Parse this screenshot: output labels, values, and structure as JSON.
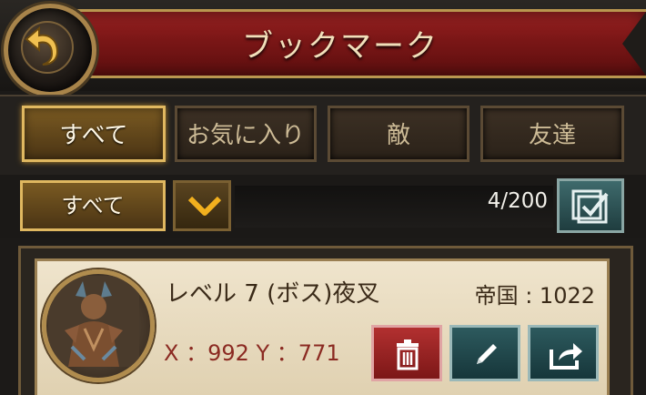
{
  "header": {
    "title": "ブックマーク",
    "back_icon": "back-arrow-icon"
  },
  "tabs": [
    {
      "label": "すべて",
      "active": true
    },
    {
      "label": "お気に入り",
      "active": false
    },
    {
      "label": "敵",
      "active": false
    },
    {
      "label": "友達",
      "active": false
    }
  ],
  "filter": {
    "selected": "すべて",
    "count": "4/200"
  },
  "bookmarks": [
    {
      "name": "レベル 7 (ボス)夜叉",
      "empire": "帝国 : 1022",
      "coords": "X ：992 Y ：771"
    }
  ],
  "colors": {
    "banner_red": "#7a1616",
    "gold_border": "#e0b860",
    "delete_red": "#b23030",
    "teal_button": "#2d5a5e",
    "coords_text": "#8b2a22"
  }
}
